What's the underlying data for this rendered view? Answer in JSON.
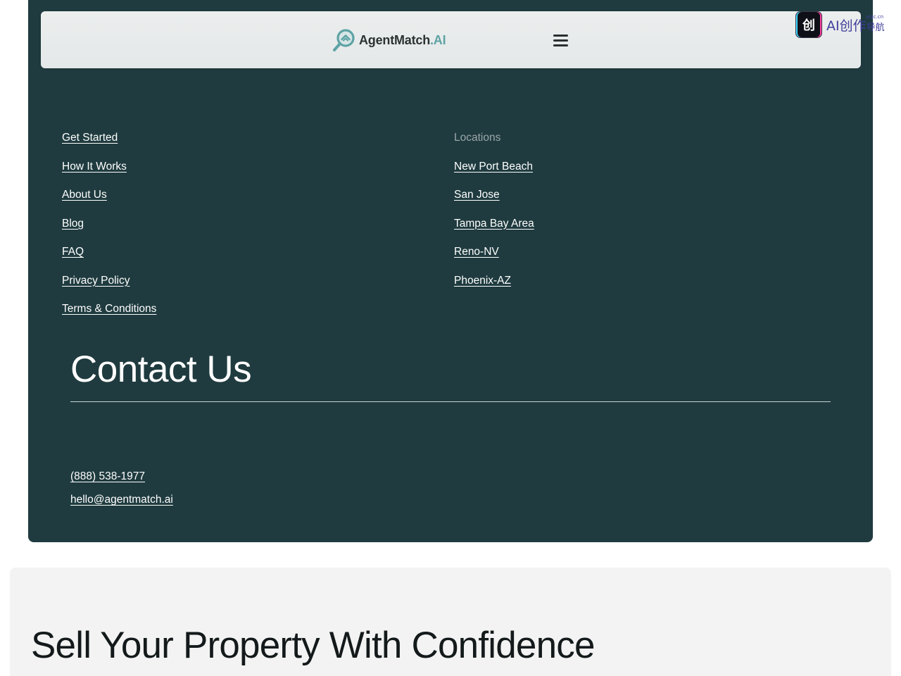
{
  "header": {
    "logo_name": "AgentMatch",
    "logo_suffix": ".AI",
    "logo_icon": "magnifier-house-logo-icon",
    "menu_icon": "hamburger-menu-icon"
  },
  "badge": {
    "icon_glyph": "创",
    "label": "AI创作",
    "label_sub": "导航",
    "label_tiny": "aigc.cn"
  },
  "footer": {
    "left_links": [
      "Get Started",
      "How It Works",
      "About Us",
      "Blog",
      "FAQ",
      "Privacy Policy",
      "Terms & Conditions"
    ],
    "locations_heading": "Locations",
    "location_links": [
      "New Port Beach",
      "San Jose",
      "Tampa Bay Area",
      "Reno-NV",
      "Phoenix-AZ"
    ]
  },
  "contact": {
    "title": "Contact Us",
    "phone": "(888) 538-1977",
    "email": "hello@agentmatch.ai"
  },
  "sell": {
    "title": "Sell Your Property With Confidence"
  },
  "colors": {
    "footer_bg": "#1f3b3f",
    "header_bg": "#e6e9e9",
    "accent_teal": "#5ea3a5",
    "sell_bg": "#f3f3f3"
  }
}
